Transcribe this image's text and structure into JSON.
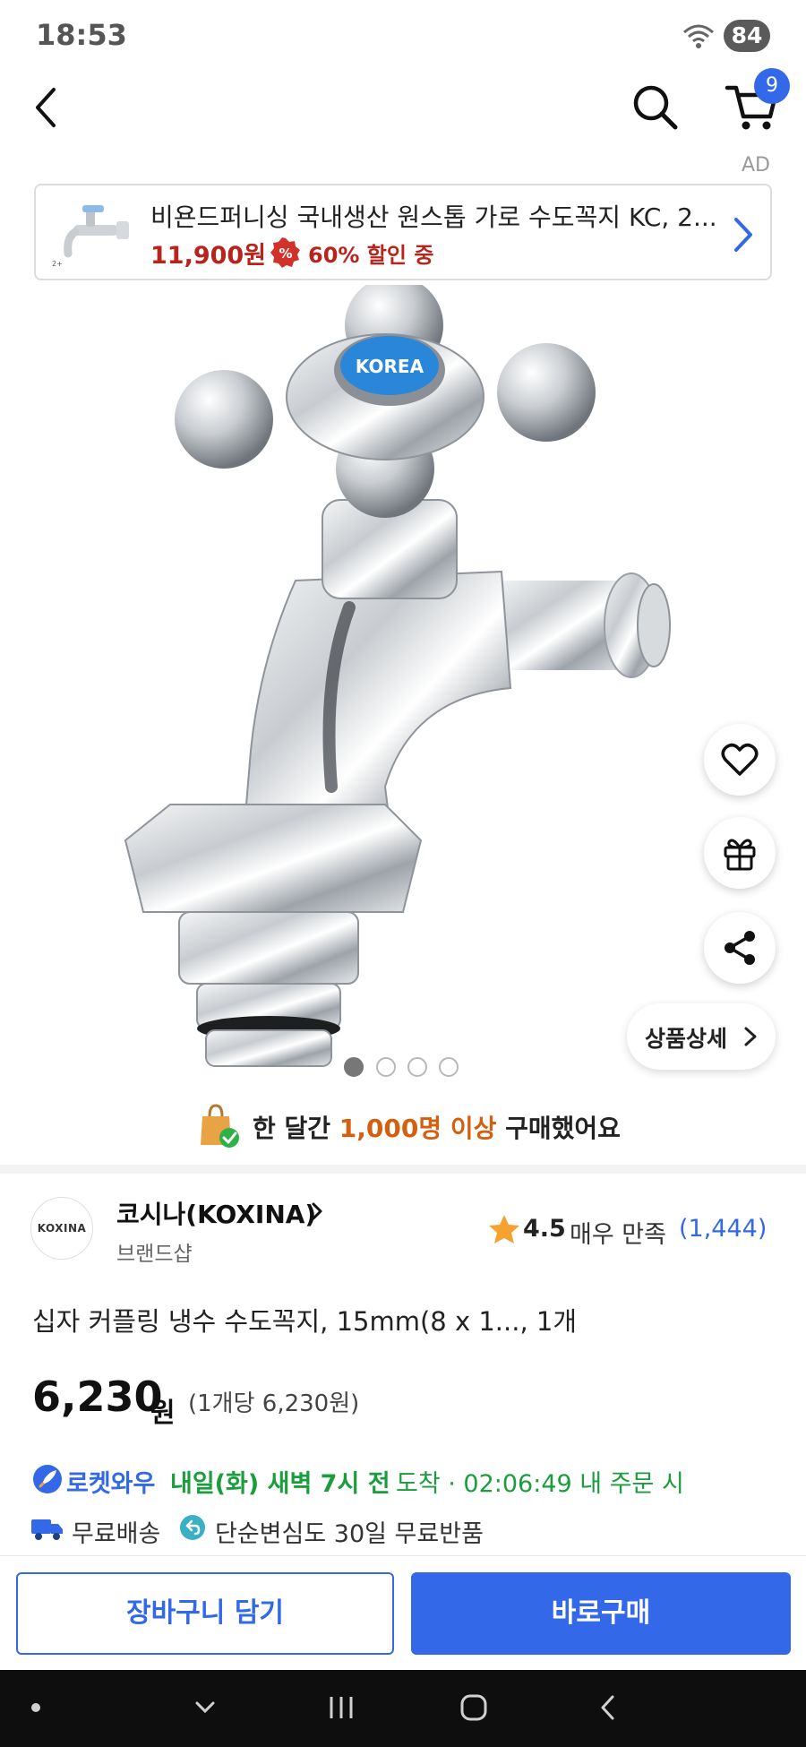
{
  "status_bar": {
    "time": "18:53",
    "battery": "84"
  },
  "nav": {
    "cart_count": "9"
  },
  "ad": {
    "label": "AD",
    "title": "비욘드퍼니싱 국내생산 원스톱 가로 수도꼭지 KC, 2...",
    "price": "11,900원",
    "discount": "60% 할인 중"
  },
  "carousel": {
    "total": 4,
    "active_index": 0
  },
  "detail_button": {
    "label": "상품상세"
  },
  "social_proof": {
    "prefix": "한 달간 ",
    "highlight": "1,000명 이상",
    "suffix": " 구매했어요"
  },
  "brand": {
    "logo_text": "KOXINA",
    "name": "코시나(KOXINA)",
    "subtitle": "브랜드샵"
  },
  "rating": {
    "score": "4.5",
    "label": "매우 만족",
    "count": "(1,444)"
  },
  "product": {
    "title": "십자 커플링 냉수 수도꼭지, 15mm(8 x 1..., 1개",
    "price": "6,230",
    "price_unit": "원",
    "price_per": "(1개당 6,230원)"
  },
  "delivery": {
    "rocket_label": "로켓와우",
    "date": "내일(화) 새벽 7시 전",
    "rest": "도착 · 02:06:49 내 주문 시",
    "free_shipping": "무료배송",
    "free_return": "단순변심도 30일 무료반품"
  },
  "actions": {
    "add_to_cart": "장바구니 담기",
    "buy_now": "바로구매"
  },
  "colors": {
    "accent_blue": "#3369e8",
    "price_red": "#b8241b",
    "delivery_green": "#1a9d3c",
    "highlight_orange": "#d35f0f"
  }
}
